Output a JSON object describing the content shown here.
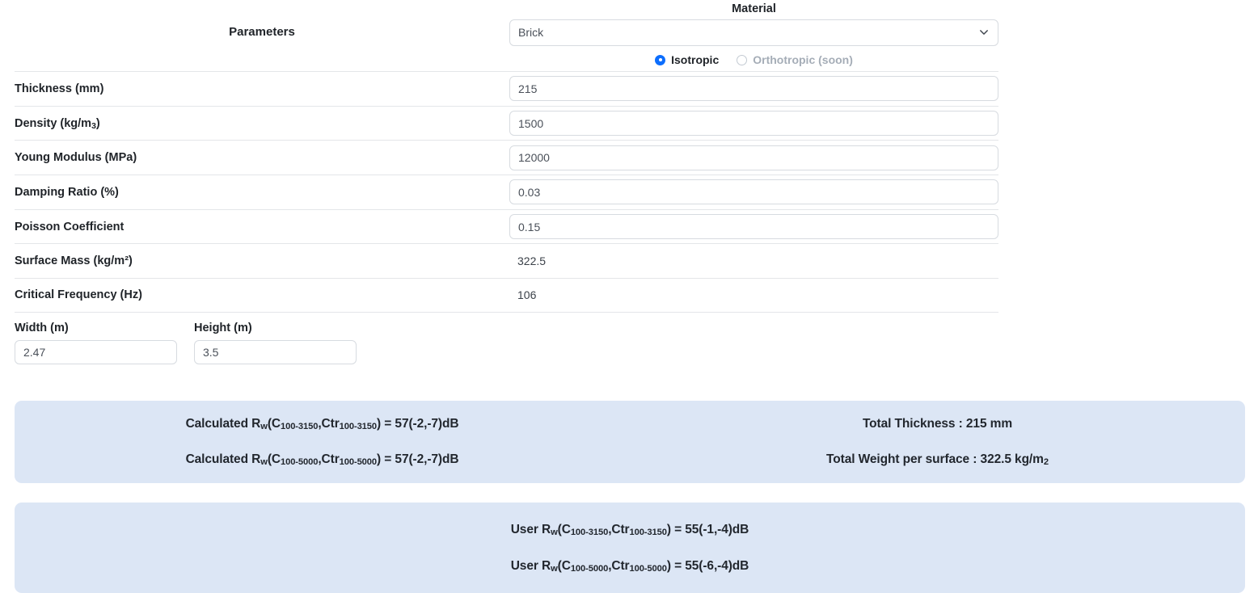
{
  "table": {
    "header": {
      "parameters_label": "Parameters",
      "material_label": "Material",
      "material_value": "Brick",
      "chevron_icon": "chevron-down-icon",
      "material_type": [
        {
          "label": "Isotropic",
          "selected": true
        },
        {
          "label": "Orthotropic (soon)",
          "selected": false
        }
      ]
    },
    "rows": [
      {
        "label": "Thickness (mm)",
        "value": "215",
        "editable": true
      },
      {
        "label": "Density (kg/m",
        "label_sub": "3",
        "label_tail": ")",
        "value": "1500",
        "editable": true
      },
      {
        "label": "Young Modulus (MPa)",
        "value": "12000",
        "editable": true
      },
      {
        "label": "Damping Ratio (%)",
        "value": "0.03",
        "editable": true
      },
      {
        "label": "Poisson Coefficient",
        "value": "0.15",
        "editable": true
      },
      {
        "label": "Surface Mass (kg/m²)",
        "value": "322.5",
        "editable": false
      },
      {
        "label": "Critical Frequency (Hz)",
        "value": "106",
        "editable": false
      }
    ]
  },
  "dimensions": {
    "width": {
      "label": "Width (m)",
      "value": "2.47"
    },
    "height": {
      "label": "Height (m)",
      "value": "3.5"
    }
  },
  "results": {
    "calculated": {
      "line1": {
        "prefix": "Calculated R",
        "prefix_sub": "w",
        "open": "(C",
        "sub1": "100-3150",
        "mid": ",Ctr",
        "sub2": "100-3150",
        "tail": ") = 57(-2,-7)dB"
      },
      "line2": {
        "prefix": "Calculated R",
        "prefix_sub": "w",
        "open": "(C",
        "sub1": "100-5000",
        "mid": ",Ctr",
        "sub2": "100-5000",
        "tail": ") = 57(-2,-7)dB"
      },
      "total_thickness": "Total Thickness : 215 mm",
      "total_weight_prefix": "Total Weight per surface : 322.5 kg/m",
      "total_weight_sub": "2"
    },
    "user": {
      "line1": {
        "prefix": "User R",
        "prefix_sub": "w",
        "open": "(C",
        "sub1": "100-3150",
        "mid": ",Ctr",
        "sub2": "100-3150",
        "tail": ") = 55(-1,-4)dB"
      },
      "line2": {
        "prefix": "User R",
        "prefix_sub": "w",
        "open": "(C",
        "sub1": "100-5000",
        "mid": ",Ctr",
        "sub2": "100-5000",
        "tail": ") = 55(-6,-4)dB"
      }
    }
  },
  "colors": {
    "panel_bg": "#dce6f5",
    "accent": "#0d6efd",
    "border": "#d7dbe0",
    "divider": "#e4e6e9"
  }
}
